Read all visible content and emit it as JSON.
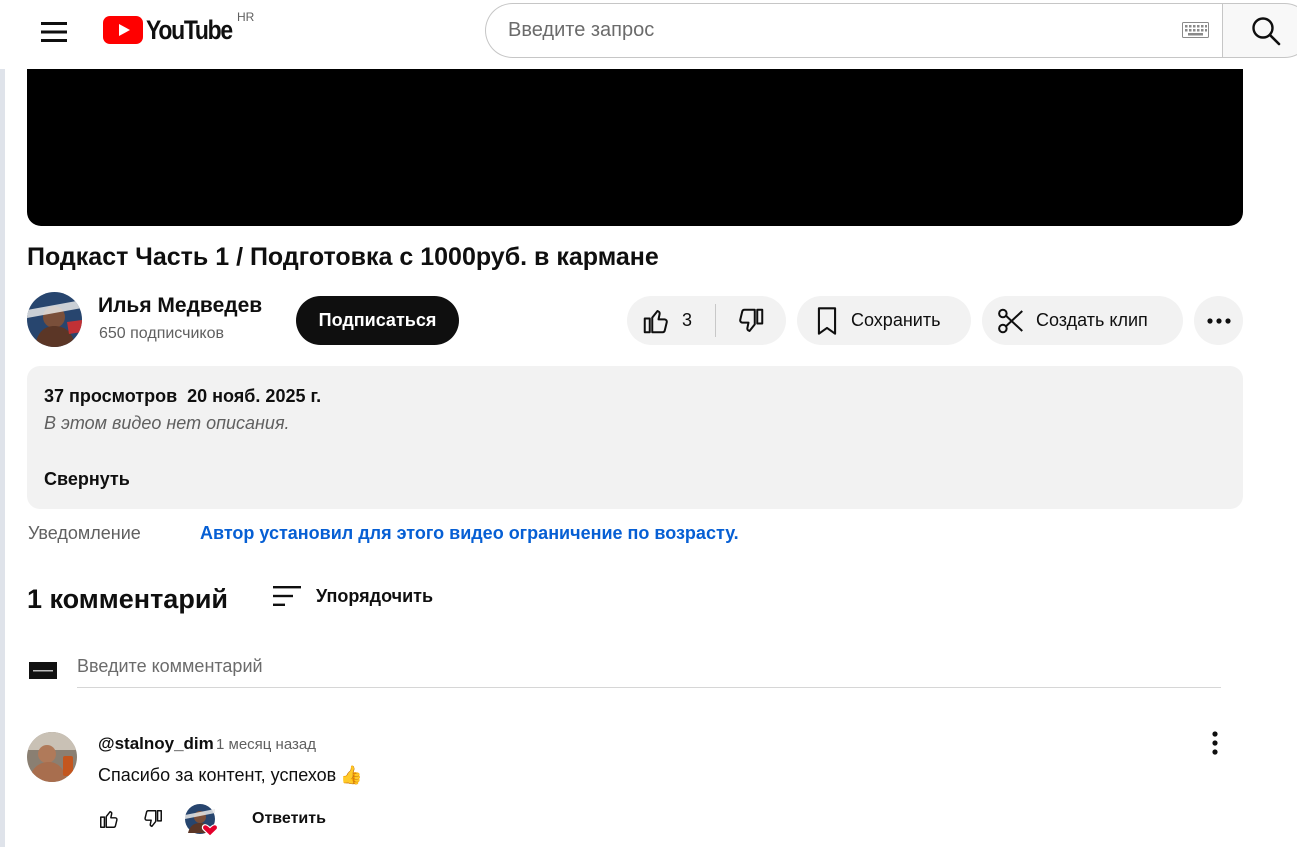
{
  "masthead": {
    "logo_text": "YouTube",
    "country_code": "HR",
    "search_placeholder": "Введите запрос",
    "icons": [
      "menu-icon",
      "youtube-play-icon",
      "keyboard-icon",
      "search-icon"
    ]
  },
  "video": {
    "title": "Подкаст Часть 1 / Подготовка с 1000руб. в кармане"
  },
  "owner": {
    "channel_name": "Илья Медведев",
    "subscribers": "650 подписчиков",
    "subscribe_label": "Подписаться"
  },
  "actions": {
    "like_count": "3",
    "save_label": "Сохранить",
    "clip_label": "Создать клип"
  },
  "description": {
    "meta": "37 просмотров  20 нояб. 2025 г.",
    "empty_text": "В этом видео нет описания.",
    "collapse_label": "Свернуть"
  },
  "notice": {
    "label": "Уведомление",
    "link_text": "Автор установил для этого видео ограничение по возрасту."
  },
  "comments": {
    "count_label": "1 комментарий",
    "sort_label": "Упорядочить",
    "input_placeholder": "Введите комментарий",
    "items": [
      {
        "author": "@stalnoy_dim",
        "time": "1 месяц назад",
        "text": "Спасибо за контент, успехов",
        "emoji": "👍",
        "reply_label": "Ответить"
      }
    ]
  },
  "colors": {
    "brand_red": "#ff0000",
    "link_blue": "#065fd4",
    "chip_bg": "#f2f2f2",
    "heart_red": "#e4002b"
  }
}
